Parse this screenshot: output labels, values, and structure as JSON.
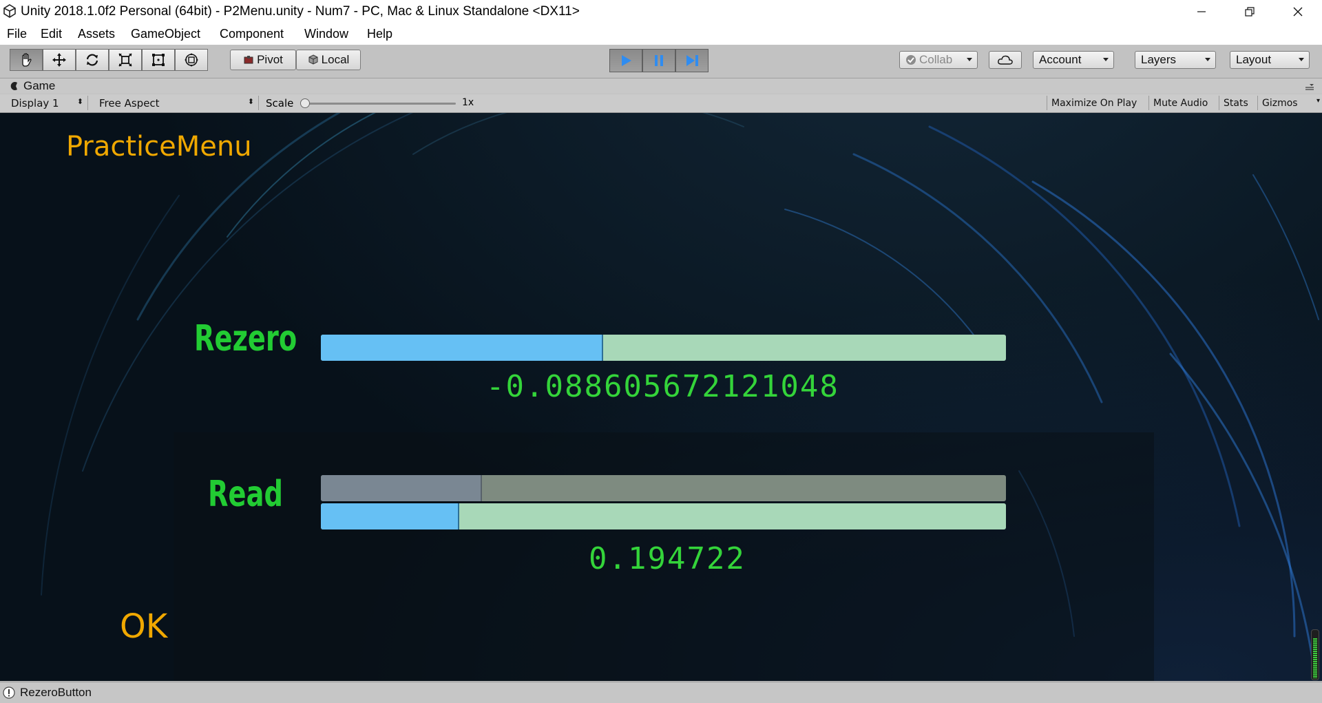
{
  "window": {
    "title": "Unity 2018.1.0f2 Personal (64bit) - P2Menu.unity - Num7 - PC, Mac & Linux Standalone <DX11>"
  },
  "menu": [
    "File",
    "Edit",
    "Assets",
    "GameObject",
    "Component",
    "Window",
    "Help"
  ],
  "toolbar": {
    "tools": [
      "hand-icon",
      "move-icon",
      "rotate-icon",
      "scale-icon",
      "rect-tool-icon",
      "transform-icon"
    ],
    "pivot_label": "Pivot",
    "local_label": "Local",
    "collab_label": "Collab",
    "account_label": "Account",
    "layers_label": "Layers",
    "layout_label": "Layout"
  },
  "game_tab": {
    "label": "Game",
    "display": "Display 1",
    "aspect": "Free Aspect",
    "scale_label": "Scale",
    "scale_value": "1x",
    "maximize": "Maximize On Play",
    "mute": "Mute Audio",
    "stats": "Stats",
    "gizmos": "Gizmos"
  },
  "game": {
    "menu_title": "PracticeMenu",
    "rezero_label": "Rezero",
    "rezero_value": "-0.088605672121048",
    "rezero_fill": 0.41,
    "read_label": "Read",
    "read_top_fill": 0.233,
    "read_bottom_fill": 0.2,
    "read_value": "0.194722",
    "ok_label": "OK"
  },
  "status": {
    "message": "RezeroButton"
  },
  "colors": {
    "accent_blue": "#2f8cf0",
    "bar_fill_blue": "#66c0f4",
    "bar_track_green": "#a8d8b8",
    "bar_top_fill": "#7a8793",
    "bar_top_track": "#7e8b80",
    "label_green": "#22cc33",
    "orange": "#f0a800"
  }
}
